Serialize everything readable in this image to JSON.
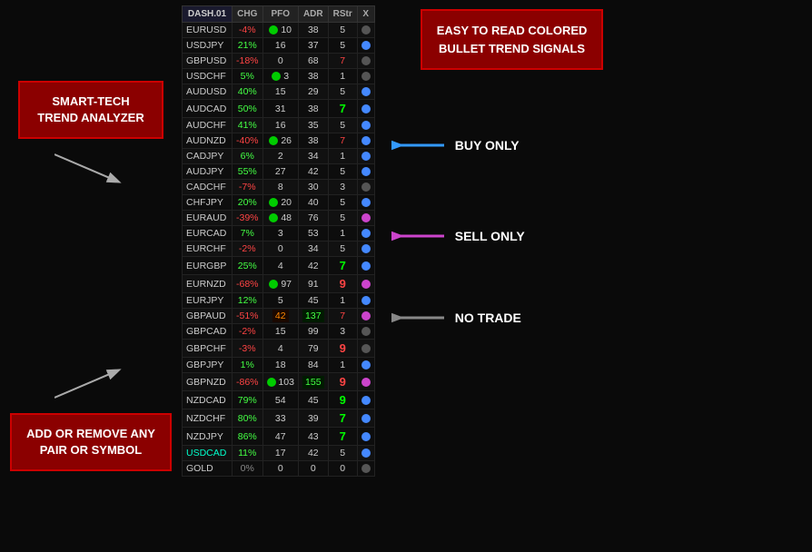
{
  "leftPanel": {
    "trendLabel": "SMART-TECH\nTREND ANALYZER",
    "pairLabel": "ADD OR REMOVE ANY\nPAIR OR SYMBOL"
  },
  "rightPanel": {
    "titleLine1": "EASY TO READ COLORED",
    "titleLine2": "BULLET TREND SIGNALS",
    "buyOnly": "BUY ONLY",
    "sellOnly": "SELL ONLY",
    "noTrade": "NO TRADE"
  },
  "table": {
    "headers": [
      "DASH.01",
      "CHG",
      "PFO",
      "ADR",
      "RStr",
      "X"
    ],
    "rows": [
      {
        "sym": "EURUSD",
        "chg": "-4%",
        "chgType": "neg",
        "pfo": "10",
        "pfoColor": "green",
        "adr": "38",
        "adrColor": "normal",
        "rstr": "5",
        "rstrColor": "normal",
        "bullet": "gray"
      },
      {
        "sym": "USDJPY",
        "chg": "21%",
        "chgType": "pos",
        "pfo": "16",
        "pfoColor": "normal",
        "adr": "37",
        "adrColor": "normal",
        "rstr": "5",
        "rstrColor": "normal",
        "bullet": "blue"
      },
      {
        "sym": "GBPUSD",
        "chg": "-18%",
        "chgType": "neg",
        "pfo": "0",
        "pfoColor": "normal",
        "adr": "68",
        "adrColor": "normal",
        "rstr": "7",
        "rstrColor": "red",
        "bullet": "gray"
      },
      {
        "sym": "USDCHF",
        "chg": "5%",
        "chgType": "pos",
        "pfo": "3",
        "pfoColor": "green",
        "adr": "38",
        "adrColor": "normal",
        "rstr": "1",
        "rstrColor": "normal",
        "bullet": "gray"
      },
      {
        "sym": "AUDUSD",
        "chg": "40%",
        "chgType": "pos",
        "pfo": "15",
        "pfoColor": "normal",
        "adr": "29",
        "adrColor": "normal",
        "rstr": "5",
        "rstrColor": "normal",
        "bullet": "blue"
      },
      {
        "sym": "AUDCAD",
        "chg": "50%",
        "chgType": "pos",
        "pfo": "31",
        "pfoColor": "normal",
        "adr": "38",
        "adrColor": "normal",
        "rstr": "7",
        "rstrColor": "green-bold",
        "bullet": "blue"
      },
      {
        "sym": "AUDCHF",
        "chg": "41%",
        "chgType": "pos",
        "pfo": "16",
        "pfoColor": "normal",
        "adr": "35",
        "adrColor": "normal",
        "rstr": "5",
        "rstrColor": "normal",
        "bullet": "blue"
      },
      {
        "sym": "AUDNZD",
        "chg": "-40%",
        "chgType": "neg",
        "pfo": "26",
        "pfoColor": "green",
        "adr": "38",
        "adrColor": "normal",
        "rstr": "7",
        "rstrColor": "red",
        "bullet": "blue"
      },
      {
        "sym": "CADJPY",
        "chg": "6%",
        "chgType": "pos",
        "pfo": "2",
        "pfoColor": "normal",
        "adr": "34",
        "adrColor": "normal",
        "rstr": "1",
        "rstrColor": "normal",
        "bullet": "blue"
      },
      {
        "sym": "AUDJPY",
        "chg": "55%",
        "chgType": "pos",
        "pfo": "27",
        "pfoColor": "normal",
        "adr": "42",
        "adrColor": "normal",
        "rstr": "5",
        "rstrColor": "normal",
        "bullet": "blue"
      },
      {
        "sym": "CADCHF",
        "chg": "-7%",
        "chgType": "neg",
        "pfo": "8",
        "pfoColor": "normal",
        "adr": "30",
        "adrColor": "normal",
        "rstr": "3",
        "rstrColor": "normal",
        "bullet": "gray"
      },
      {
        "sym": "CHFJPY",
        "chg": "20%",
        "chgType": "pos",
        "pfo": "20",
        "pfoColor": "green",
        "adr": "40",
        "adrColor": "normal",
        "rstr": "5",
        "rstrColor": "normal",
        "bullet": "blue"
      },
      {
        "sym": "EURAUD",
        "chg": "-39%",
        "chgType": "neg",
        "pfo": "48",
        "pfoColor": "green",
        "adr": "76",
        "adrColor": "normal",
        "rstr": "5",
        "rstrColor": "normal",
        "bullet": "pink"
      },
      {
        "sym": "EURCAD",
        "chg": "7%",
        "chgType": "pos",
        "pfo": "3",
        "pfoColor": "normal",
        "adr": "53",
        "adrColor": "normal",
        "rstr": "1",
        "rstrColor": "normal",
        "bullet": "blue"
      },
      {
        "sym": "EURCHF",
        "chg": "-2%",
        "chgType": "neg",
        "pfo": "0",
        "pfoColor": "normal",
        "adr": "34",
        "adrColor": "normal",
        "rstr": "5",
        "rstrColor": "normal",
        "bullet": "blue"
      },
      {
        "sym": "EURGBP",
        "chg": "25%",
        "chgType": "pos",
        "pfo": "4",
        "pfoColor": "normal",
        "adr": "42",
        "adrColor": "normal",
        "rstr": "7",
        "rstrColor": "green-bold",
        "bullet": "blue"
      },
      {
        "sym": "EURNZD",
        "chg": "-68%",
        "chgType": "neg",
        "pfo": "97",
        "pfoColor": "green",
        "adr": "91",
        "adrColor": "normal",
        "rstr": "9",
        "rstrColor": "red-bold",
        "bullet": "pink"
      },
      {
        "sym": "EURJPY",
        "chg": "12%",
        "chgType": "pos",
        "pfo": "5",
        "pfoColor": "normal",
        "adr": "45",
        "adrColor": "normal",
        "rstr": "1",
        "rstrColor": "normal",
        "bullet": "blue"
      },
      {
        "sym": "GBPAUD",
        "chg": "-51%",
        "chgType": "neg",
        "pfo": "42",
        "pfoColor": "orange",
        "adr": "137",
        "adrColor": "green",
        "rstr": "7",
        "rstrColor": "red",
        "bullet": "pink"
      },
      {
        "sym": "GBPCAD",
        "chg": "-2%",
        "chgType": "neg",
        "pfo": "15",
        "pfoColor": "normal",
        "adr": "99",
        "adrColor": "normal",
        "rstr": "3",
        "rstrColor": "normal",
        "bullet": "gray"
      },
      {
        "sym": "GBPCHF",
        "chg": "-3%",
        "chgType": "neg",
        "pfo": "4",
        "pfoColor": "normal",
        "adr": "79",
        "adrColor": "normal",
        "rstr": "9",
        "rstrColor": "red-bold",
        "bullet": "gray"
      },
      {
        "sym": "GBPJPY",
        "chg": "1%",
        "chgType": "pos",
        "pfo": "18",
        "pfoColor": "normal",
        "adr": "84",
        "adrColor": "normal",
        "rstr": "1",
        "rstrColor": "normal",
        "bullet": "blue"
      },
      {
        "sym": "GBPNZD",
        "chg": "-86%",
        "chgType": "neg",
        "pfo": "103",
        "pfoColor": "green",
        "adr": "155",
        "adrColor": "green",
        "rstr": "9",
        "rstrColor": "red-bold",
        "bullet": "pink"
      },
      {
        "sym": "NZDCAD",
        "chg": "79%",
        "chgType": "pos",
        "pfo": "54",
        "pfoColor": "normal",
        "adr": "45",
        "adrColor": "normal",
        "rstr": "9",
        "rstrColor": "green-bold",
        "bullet": "blue"
      },
      {
        "sym": "NZDCHF",
        "chg": "80%",
        "chgType": "pos",
        "pfo": "33",
        "pfoColor": "normal",
        "adr": "39",
        "adrColor": "normal",
        "rstr": "7",
        "rstrColor": "green-bold",
        "bullet": "blue"
      },
      {
        "sym": "NZDJPY",
        "chg": "86%",
        "chgType": "pos",
        "pfo": "47",
        "pfoColor": "normal",
        "adr": "43",
        "adrColor": "normal",
        "rstr": "7",
        "rstrColor": "green-bold",
        "bullet": "blue"
      },
      {
        "sym": "USDCAD",
        "chg": "11%",
        "chgType": "pos",
        "pfo": "17",
        "pfoColor": "normal",
        "adr": "42",
        "adrColor": "normal",
        "rstr": "5",
        "rstrColor": "normal",
        "bullet": "blue",
        "symColor": "cyan"
      },
      {
        "sym": "GOLD",
        "chg": "0%",
        "chgType": "neutral",
        "pfo": "0",
        "pfoColor": "normal",
        "adr": "0",
        "adrColor": "normal",
        "rstr": "0",
        "rstrColor": "normal",
        "bullet": "gray"
      }
    ]
  }
}
